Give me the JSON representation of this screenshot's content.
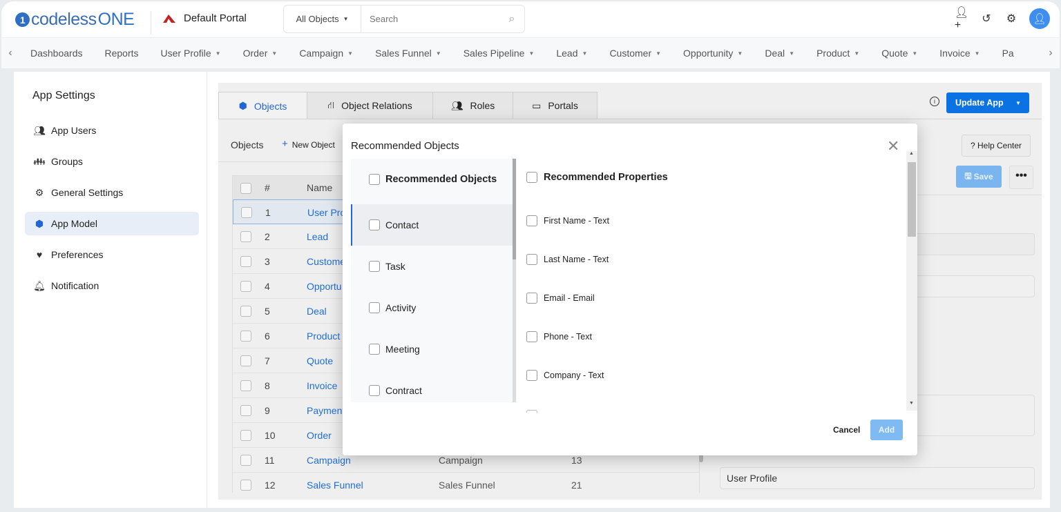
{
  "header": {
    "logo": "codelessONE",
    "portal": "Default Portal",
    "search_scope": "All Objects",
    "search_placeholder": "Search"
  },
  "nav": [
    "Dashboards",
    "Reports",
    "User Profile",
    "Order",
    "Campaign",
    "Sales Funnel",
    "Sales Pipeline",
    "Lead",
    "Customer",
    "Opportunity",
    "Deal",
    "Product",
    "Quote",
    "Invoice",
    "Pa"
  ],
  "nav_dropdowns": [
    false,
    false,
    true,
    true,
    true,
    true,
    true,
    true,
    true,
    true,
    true,
    true,
    true,
    true,
    false
  ],
  "sidebar": {
    "title": "App Settings",
    "items": [
      {
        "label": "App Users",
        "icon": "users-icon"
      },
      {
        "label": "Groups",
        "icon": "groups-icon"
      },
      {
        "label": "General Settings",
        "icon": "gear-icon"
      },
      {
        "label": "App Model",
        "icon": "cube-icon",
        "active": true
      },
      {
        "label": "Preferences",
        "icon": "hand-heart-icon"
      },
      {
        "label": "Notification",
        "icon": "bell-icon"
      }
    ]
  },
  "tabs": [
    {
      "label": "Objects",
      "active": true
    },
    {
      "label": "Object Relations"
    },
    {
      "label": "Roles"
    },
    {
      "label": "Portals"
    }
  ],
  "toolbar": {
    "objects_label": "Objects",
    "new_object": "New Object",
    "update_app": "Update App",
    "help_center": "Help Center",
    "save": "Save"
  },
  "table": {
    "headers": [
      "#",
      "Name"
    ],
    "rows": [
      [
        "1",
        "User Pro",
        "",
        ""
      ],
      [
        "2",
        "Lead",
        "",
        ""
      ],
      [
        "3",
        "Custome",
        "",
        ""
      ],
      [
        "4",
        "Opportu",
        "",
        ""
      ],
      [
        "5",
        "Deal",
        "",
        ""
      ],
      [
        "6",
        "Product",
        "",
        ""
      ],
      [
        "7",
        "Quote",
        "",
        ""
      ],
      [
        "8",
        "Invoice",
        "",
        ""
      ],
      [
        "9",
        "Payment",
        "",
        ""
      ],
      [
        "10",
        "Order",
        "",
        ""
      ],
      [
        "11",
        "Campaign",
        "Campaign",
        "13"
      ],
      [
        "12",
        "Sales Funnel",
        "Sales Funnel",
        "21"
      ]
    ]
  },
  "detail": {
    "field_value": "User Profile"
  },
  "modal": {
    "title": "Recommended Objects",
    "objects_header": "Recommended Objects",
    "objects": [
      "Contact",
      "Task",
      "Activity",
      "Meeting",
      "Contract"
    ],
    "active_object": "Contact",
    "properties_header": "Recommended Properties",
    "properties": [
      "First Name - Text",
      "Last Name - Text",
      "Email - Email",
      "Phone - Text",
      "Company - Text"
    ],
    "cancel": "Cancel",
    "add": "Add"
  },
  "colors": {
    "primary": "#0a72e3",
    "link": "#1f6ed6",
    "disabled_primary": "#7fbaf3"
  }
}
